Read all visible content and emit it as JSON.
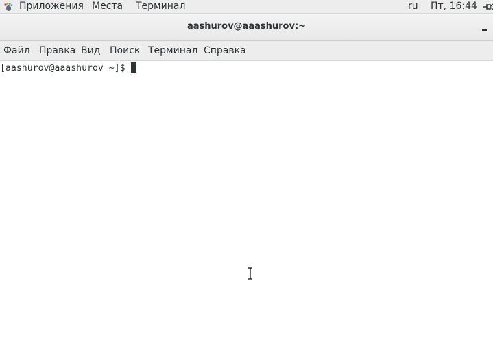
{
  "top_panel": {
    "applications": "Приложения",
    "places": "Места",
    "terminal": "Терминал",
    "keyboard_layout": "ru",
    "clock": "Пт, 16:44",
    "apps_icon": "gnome-foot-icon"
  },
  "window": {
    "title": "aashurov@aaashurov:~",
    "minimize_icon": "minimize-icon"
  },
  "menu": {
    "file": "Файл",
    "edit": "Правка",
    "view": "Вид",
    "search": "Поиск",
    "terminal": "Терминал",
    "help": "Справка"
  },
  "terminal": {
    "prompt": "[aashurov@aaashurov ~]$ ",
    "text_color": "#2e3436",
    "background": "#ffffff"
  },
  "pointer": {
    "icon": "text-cursor-ibeam-icon"
  }
}
